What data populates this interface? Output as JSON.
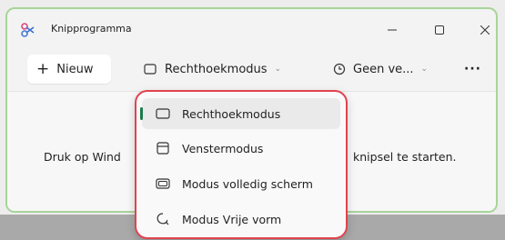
{
  "window": {
    "title": "Knipprogramma"
  },
  "titlebar": {
    "min_icon": "minimize-icon",
    "max_icon": "maximize-icon",
    "close_icon": "close-icon"
  },
  "toolbar": {
    "new_label": "Nieuw",
    "mode_label": "Rechthoekmodus",
    "delay_label": "Geen ve...",
    "more_label": "···"
  },
  "content": {
    "message_left": "Druk op Wind",
    "message_right": "knipsel te starten."
  },
  "menu": {
    "items": [
      {
        "label": "Rechthoekmodus",
        "icon": "rectangle-icon",
        "selected": true
      },
      {
        "label": "Venstermodus",
        "icon": "window-icon",
        "selected": false
      },
      {
        "label": "Modus volledig scherm",
        "icon": "fullscreen-icon",
        "selected": false
      },
      {
        "label": "Modus Vrije vorm",
        "icon": "freeform-icon",
        "selected": false
      }
    ]
  },
  "colors": {
    "menu_border": "#e0434f",
    "window_border": "#a8d49a",
    "selection_bar": "#1d7a4d"
  }
}
